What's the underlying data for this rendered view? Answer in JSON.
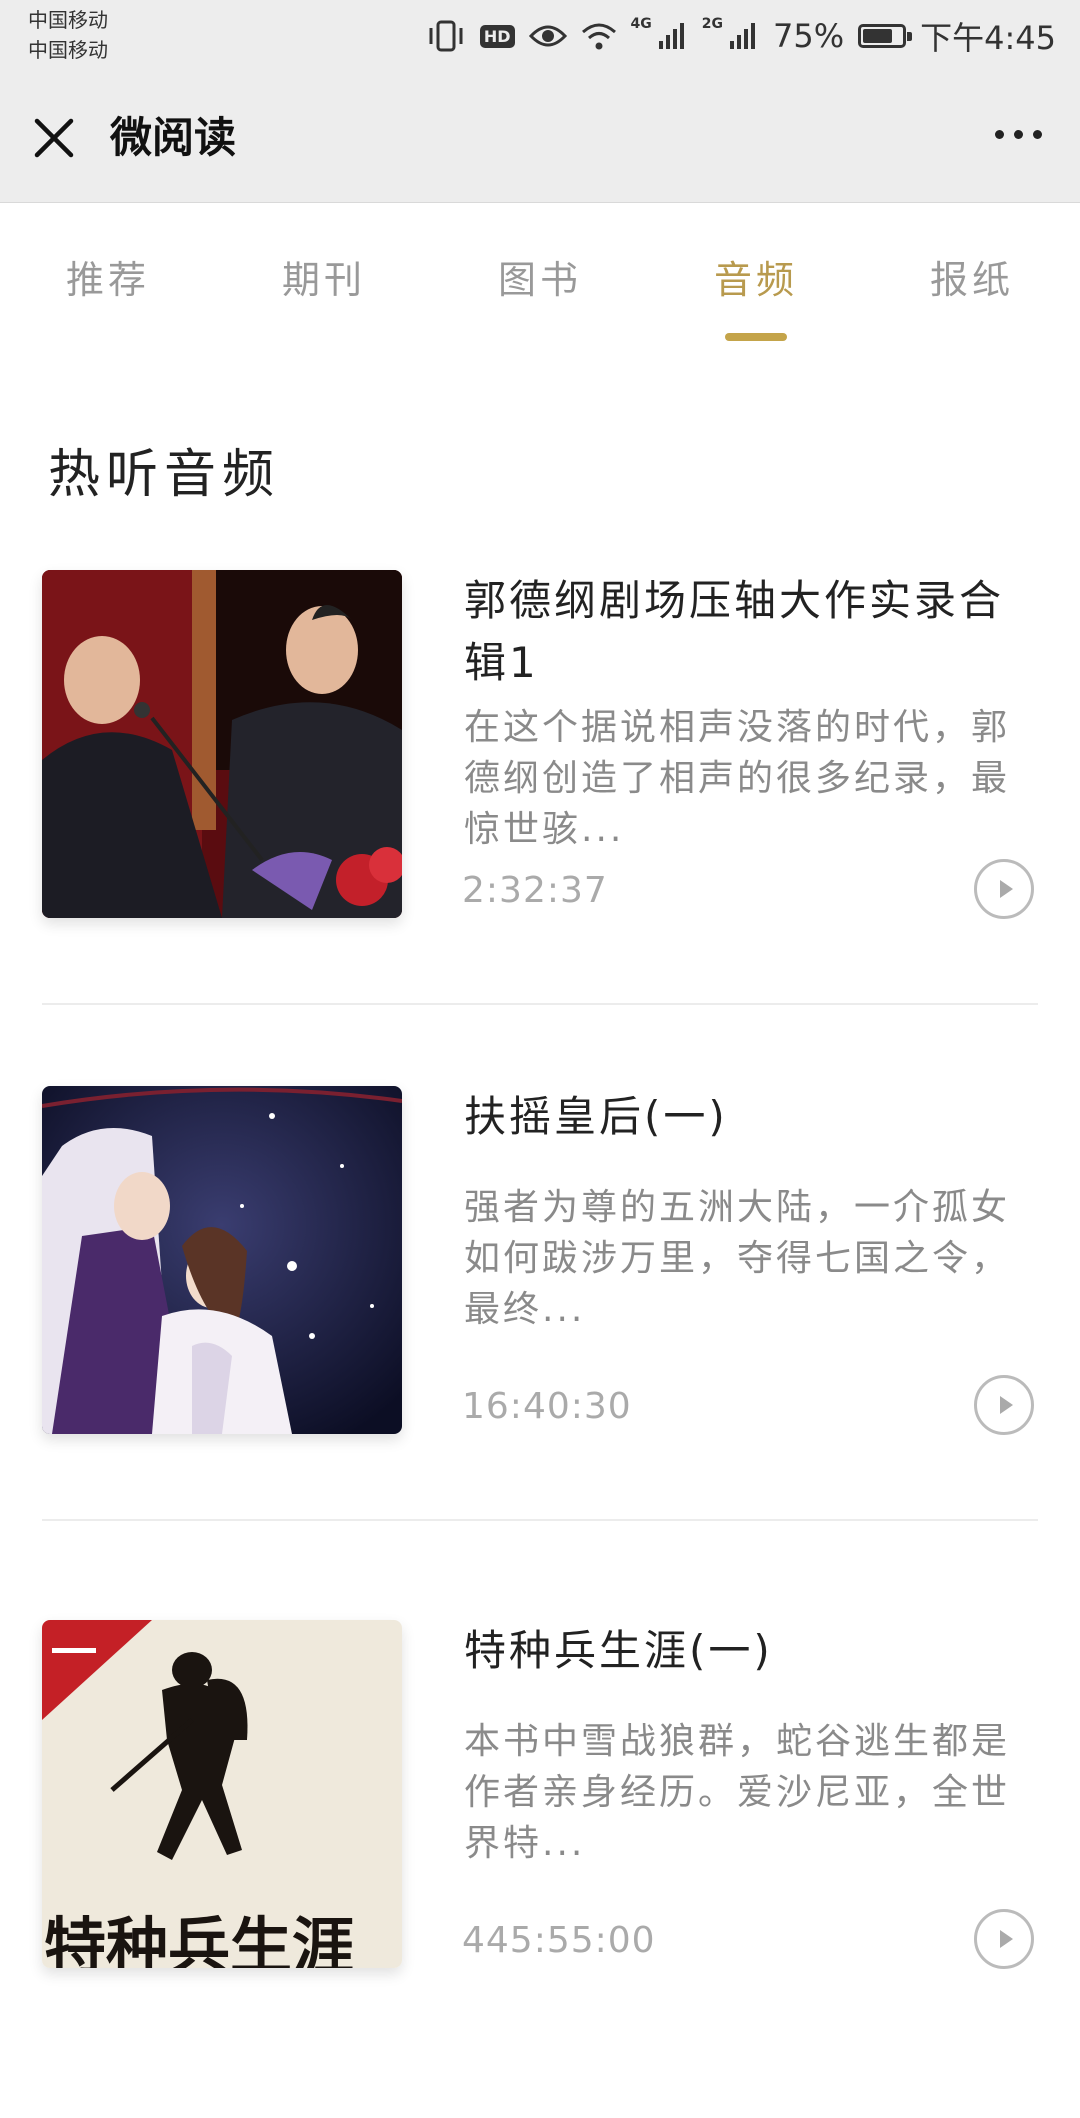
{
  "status_bar": {
    "carrier_1": "中国移动",
    "carrier_2": "中国移动",
    "hd": "HD",
    "net_1": "4G",
    "net_2": "2G",
    "battery": "75%",
    "battery_level": 0.75,
    "time": "下午4:45"
  },
  "nav": {
    "title": "微阅读"
  },
  "tabs": [
    {
      "label": "推荐",
      "active": false
    },
    {
      "label": "期刊",
      "active": false
    },
    {
      "label": "图书",
      "active": false
    },
    {
      "label": "音频",
      "active": true
    },
    {
      "label": "报纸",
      "active": false
    }
  ],
  "section": {
    "title": "热听音频"
  },
  "items": [
    {
      "title": "郭德纲剧场压轴大作实录合辑1",
      "description": "在这个据说相声没落的时代，郭德纲创造了相声的很多纪录，最惊世骇...",
      "duration": "2:32:37"
    },
    {
      "title": "扶摇皇后(一)",
      "description": "强者为尊的五洲大陆，一介孤女如何跋涉万里，夺得七国之令，最终...",
      "duration": "16:40:30"
    },
    {
      "title": "特种兵生涯(一)",
      "description": "本书中雪战狼群，蛇谷逃生都是作者亲身经历。爱沙尼亚，全世界特...",
      "duration": "445:55:00",
      "cover_text": "特种兵生涯"
    }
  ],
  "colors": {
    "accent": "#c4a44a",
    "nav_bg": "#ededed"
  }
}
